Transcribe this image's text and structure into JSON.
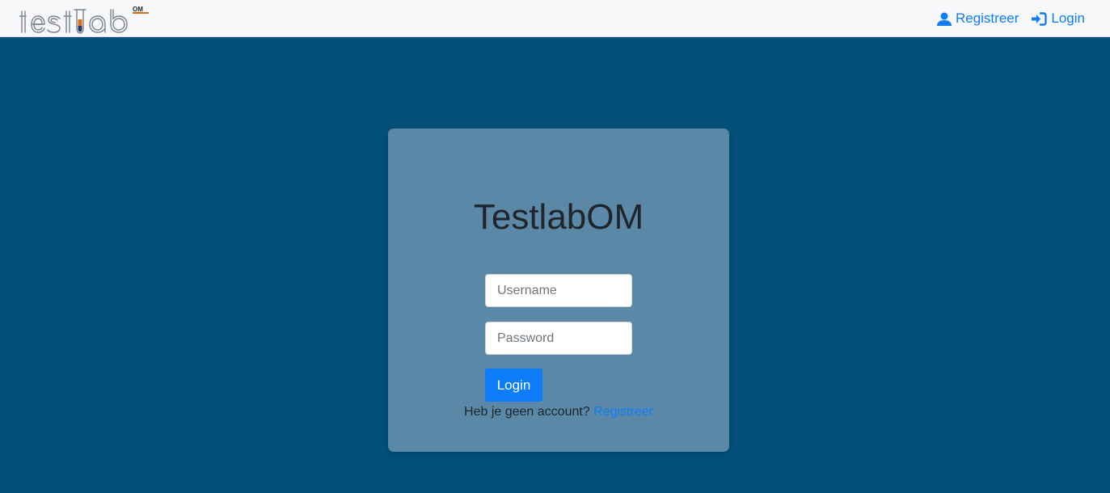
{
  "navbar": {
    "logo_text": "testlab",
    "logo_badge": "OM",
    "links": [
      {
        "label": "Registreer",
        "icon": "user-icon"
      },
      {
        "label": "Login",
        "icon": "sign-in-icon"
      }
    ]
  },
  "login_card": {
    "title": "TestlabOM",
    "username_placeholder": "Username",
    "password_placeholder": "Password",
    "submit_label": "Login",
    "signup_prompt": "Heb je geen account?",
    "signup_link_label": "Registreer"
  },
  "colors": {
    "page_background": "#024f79",
    "card_background": "#5a88a6",
    "accent": "#0d7dfb",
    "navbar_background": "#f7f8f9"
  }
}
